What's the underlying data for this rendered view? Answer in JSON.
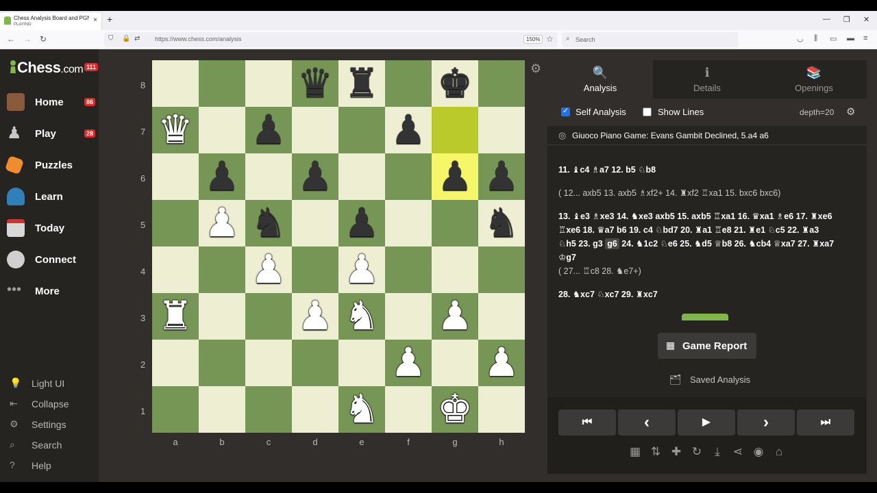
{
  "browser": {
    "tab_title": "Chess Analysis Board and PGN",
    "tab_subtitle": "PLAYING",
    "url": "https://www.chess.com/analysis",
    "zoom": "150%",
    "search_placeholder": "Search"
  },
  "sidebar": {
    "logo_text": "Chess",
    "logo_suffix": ".com",
    "logo_badge": "111",
    "nav": [
      {
        "label": "Home",
        "badge": "86"
      },
      {
        "label": "Play",
        "badge": "28"
      },
      {
        "label": "Puzzles"
      },
      {
        "label": "Learn"
      },
      {
        "label": "Today"
      },
      {
        "label": "Connect"
      },
      {
        "label": "More"
      }
    ],
    "footer": [
      {
        "label": "Light UI"
      },
      {
        "label": "Collapse"
      },
      {
        "label": "Settings"
      },
      {
        "label": "Search"
      },
      {
        "label": "Help"
      }
    ]
  },
  "board": {
    "ranks": [
      "8",
      "7",
      "6",
      "5",
      "4",
      "3",
      "2",
      "1"
    ],
    "files": [
      "a",
      "b",
      "c",
      "d",
      "e",
      "f",
      "g",
      "h"
    ],
    "highlight": [
      "g7",
      "g6"
    ],
    "pieces": [
      {
        "sq": "d8",
        "glyph": "♛",
        "color": "b"
      },
      {
        "sq": "e8",
        "glyph": "♜",
        "color": "b"
      },
      {
        "sq": "g8",
        "glyph": "♚",
        "color": "b"
      },
      {
        "sq": "a7",
        "glyph": "♛",
        "color": "w"
      },
      {
        "sq": "c7",
        "glyph": "♟",
        "color": "b"
      },
      {
        "sq": "f7",
        "glyph": "♟",
        "color": "b"
      },
      {
        "sq": "b6",
        "glyph": "♟",
        "color": "b"
      },
      {
        "sq": "d6",
        "glyph": "♟",
        "color": "b"
      },
      {
        "sq": "g6",
        "glyph": "♟",
        "color": "b"
      },
      {
        "sq": "h6",
        "glyph": "♟",
        "color": "b"
      },
      {
        "sq": "b5",
        "glyph": "♟",
        "color": "w"
      },
      {
        "sq": "c5",
        "glyph": "♞",
        "color": "b"
      },
      {
        "sq": "e5",
        "glyph": "♟",
        "color": "b"
      },
      {
        "sq": "h5",
        "glyph": "♞",
        "color": "b"
      },
      {
        "sq": "c4",
        "glyph": "♟",
        "color": "w"
      },
      {
        "sq": "e4",
        "glyph": "♟",
        "color": "w"
      },
      {
        "sq": "a3",
        "glyph": "♜",
        "color": "w"
      },
      {
        "sq": "d3",
        "glyph": "♟",
        "color": "w"
      },
      {
        "sq": "e3",
        "glyph": "♞",
        "color": "w"
      },
      {
        "sq": "g3",
        "glyph": "♟",
        "color": "w"
      },
      {
        "sq": "f2",
        "glyph": "♟",
        "color": "w"
      },
      {
        "sq": "h2",
        "glyph": "♟",
        "color": "w"
      },
      {
        "sq": "e1",
        "glyph": "♞",
        "color": "w"
      },
      {
        "sq": "g1",
        "glyph": "♚",
        "color": "w"
      }
    ]
  },
  "panel": {
    "tabs": [
      {
        "label": "Analysis",
        "icon": "🔍"
      },
      {
        "label": "Details",
        "icon": "ℹ"
      },
      {
        "label": "Openings",
        "icon": "📚"
      }
    ],
    "self_analysis_label": "Self Analysis",
    "show_lines_label": "Show Lines",
    "depth": "depth=20",
    "opening": "Giuoco Piano Game: Evans Gambit Declined, 5.a4 a6",
    "move_lines": [
      "11. ♝c4 ♗a7 12. b5 ♘b8",
      "( 12... axb5 13. axb5 ♗xf2+ 14. ♜xf2 ♖xa1 15. bxc6 bxc6)",
      "13. ♝e3 ♗xe3 14. ♞xe3 axb5 15. axb5 ♖xa1 16. ♛xa1 ♗e6 17. ♜xe6",
      "♖xe6 18. ♛a7 b6 19. c4 ♘bd7 20. ♜a1 ♖e8 21. ♜e1 ♘c5 22. ♜a3",
      "♘h5 23. g3",
      "g6",
      "24. ♞1c2 ♘e6 25. ♞d5 ♕b8 26. ♞cb4 ♕xa7 27. ♜xa7",
      "♔g7",
      "( 27... ♖c8 28. ♞e7+)",
      "28. ♞xc7 ♘xc7 29. ♜xc7"
    ],
    "game_report_label": "Game Report",
    "saved_analysis_label": "Saved Analysis",
    "controls": [
      "⏮",
      "‹",
      "▶",
      "›",
      "⏭"
    ],
    "tools": [
      "explorer-icon",
      "flip-icon",
      "add-icon",
      "reset-icon",
      "download-icon",
      "share-icon",
      "engine-icon",
      "library-icon"
    ]
  },
  "colors": {
    "light_square": "#eeeed2",
    "dark_square": "#769656",
    "highlight": "#f6f669",
    "accent": "#81b64c"
  }
}
